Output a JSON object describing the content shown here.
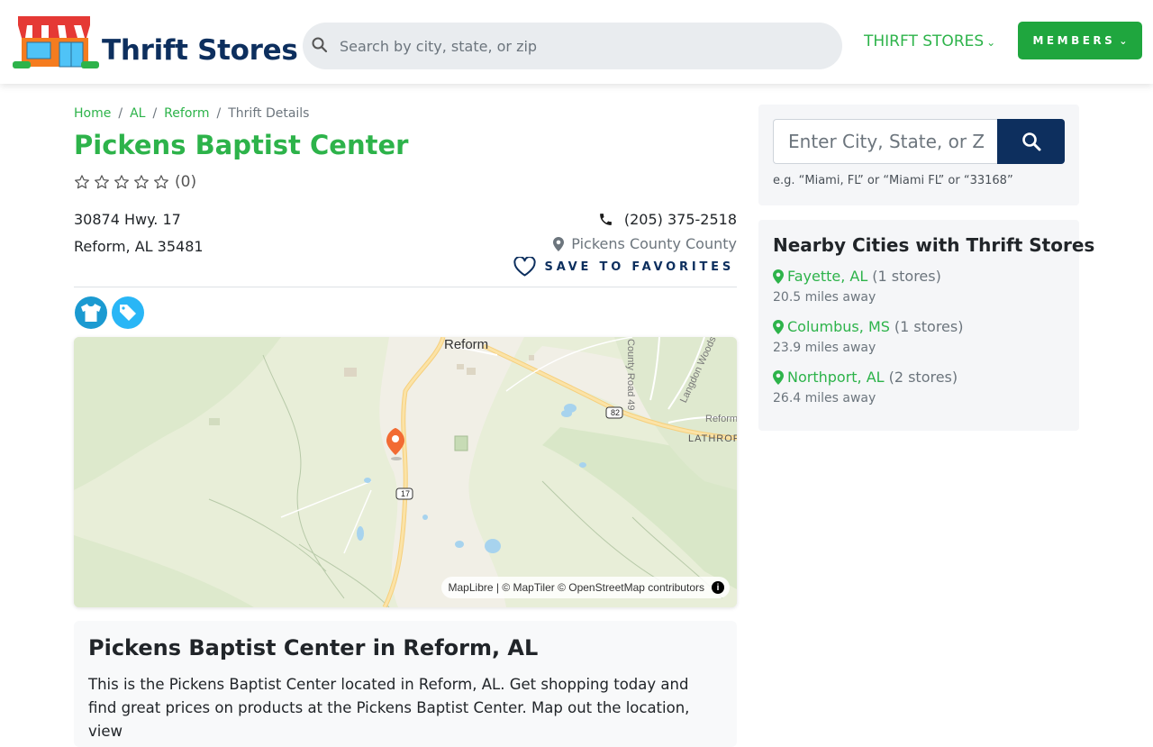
{
  "header": {
    "brand": "Thrift Stores",
    "search_placeholder": "Search by city, state, or zip",
    "nav_thrift_label": "THIRFT STORES",
    "members_label": "MEMBERS"
  },
  "breadcrumb": {
    "home": "Home",
    "state": "AL",
    "city": "Reform",
    "current": "Thrift Details"
  },
  "store": {
    "name": "Pickens Baptist Center",
    "rating": 0,
    "rating_count": "(0)",
    "address_line1": "30874 Hwy. 17",
    "address_line2": "Reform, AL 35481",
    "phone": "(205) 375-2518",
    "county": "Pickens County County",
    "favorites_label": "SAVE TO FAVORITES",
    "categories": [
      "clothing-icon",
      "tag-icon"
    ]
  },
  "map": {
    "attribution": "MapLibre | © MapTiler © OpenStreetMap contributors",
    "labels": {
      "town": "Reform",
      "road49": "County Road 49",
      "langdon": "Langdon Woods R",
      "reform_road": "Reform",
      "lathrop": "LATHROP",
      "hwy82": "82",
      "hwy17": "17"
    }
  },
  "description": {
    "title": "Pickens Baptist Center in Reform, AL",
    "text": "This is the Pickens Baptist Center located in Reform, AL. Get shopping today and find great prices on products at the Pickens Baptist Center. Map out the location, view"
  },
  "sidebar": {
    "search_placeholder": "Enter City, State, or Zip",
    "search_hint": "e.g. “Miami, FL” or “Miami FL” or “33168”",
    "nearby_title": "Nearby Cities with Thrift Stores",
    "nearby": [
      {
        "city": "Fayette, AL",
        "count": "(1 stores)",
        "distance": "20.5 miles away"
      },
      {
        "city": "Columbus, MS",
        "count": "(1 stores)",
        "distance": "23.9 miles away"
      },
      {
        "city": "Northport, AL",
        "count": "(2 stores)",
        "distance": "26.4 miles away"
      }
    ]
  },
  "colors": {
    "brand_green": "#2db34a",
    "brand_navy": "#0d2f5e",
    "members_green": "#1fa63e"
  }
}
